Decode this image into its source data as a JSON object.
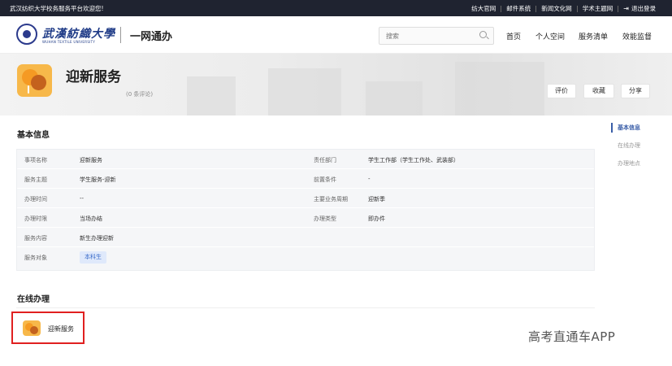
{
  "topbar": {
    "welcome": "武汉纺织大学校务服务平台欢迎您!",
    "links": [
      "纺大官网",
      "邮件系统",
      "新闻文化网",
      "学术主题网"
    ],
    "logout": "退出登录"
  },
  "header": {
    "logo_text": "武漢紡織大學",
    "logo_sub": "WUHAN TEXTILE UNIVERSITY",
    "portal_title": "一网通办",
    "search_placeholder": "搜索",
    "nav": [
      "首页",
      "个人空间",
      "服务清单",
      "效能监督"
    ]
  },
  "service": {
    "title": "迎新服务",
    "reviews": "(0 条评论)",
    "actions": [
      "评价",
      "收藏",
      "分享"
    ]
  },
  "basic_info": {
    "section_title": "基本信息",
    "rows": [
      {
        "l1": "事项名称",
        "v1": "迎新服务",
        "l2": "责任部门",
        "v2": "学生工作部（学生工作处、武装部）"
      },
      {
        "l1": "服务主题",
        "v1": "学生服务-迎新",
        "l2": "前置条件",
        "v2": "-"
      },
      {
        "l1": "办理时间",
        "v1": "--",
        "l2": "主要业务周期",
        "v2": "迎新季"
      },
      {
        "l1": "办理时限",
        "v1": "当场办结",
        "l2": "办理类型",
        "v2": "即办件"
      },
      {
        "l1": "服务内容",
        "v1": "新生办理迎新",
        "l2": "",
        "v2": ""
      },
      {
        "l1": "服务对象",
        "v1": "本科生",
        "l2": "",
        "v2": ""
      }
    ]
  },
  "toc": {
    "items": [
      "基本信息",
      "在线办理",
      "办理地点"
    ],
    "active": "基本信息"
  },
  "online": {
    "section_title": "在线办理",
    "item_label": "迎新服务"
  },
  "watermark": "高考直通车APP",
  "colors": {
    "topbar_bg": "#1f2330",
    "accent_blue": "#3a5ea8",
    "icon_orange": "#f7b84a",
    "highlight_red": "#e02020",
    "tag_bg": "#dfe9fb"
  },
  "icons": {
    "logo": "university-seal-icon",
    "search": "search-icon",
    "logout": "logout-icon",
    "service": "balloons-icon"
  }
}
